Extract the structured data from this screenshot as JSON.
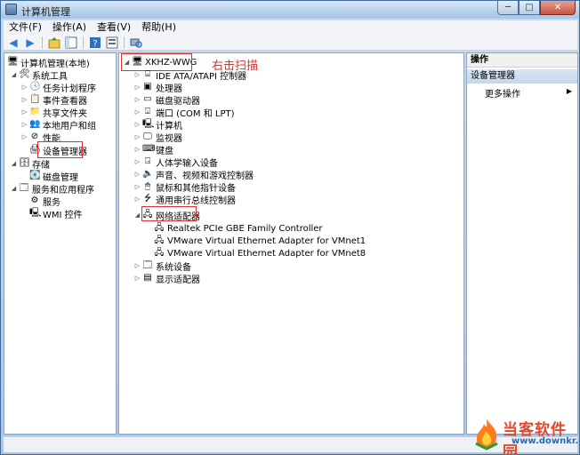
{
  "window": {
    "title": "计算机管理",
    "minimize": "─",
    "maximize": "□",
    "close": "✕"
  },
  "menu": [
    "文件(F)",
    "操作(A)",
    "查看(V)",
    "帮助(H)"
  ],
  "left_tree": {
    "root": "计算机管理(本地)",
    "system_tools": "系统工具",
    "task_scheduler": "任务计划程序",
    "event_viewer": "事件查看器",
    "shared_folders": "共享文件夹",
    "local_users": "本地用户和组",
    "performance": "性能",
    "device_manager": "设备管理器",
    "storage": "存储",
    "disk_management": "磁盘管理",
    "services_apps": "服务和应用程序",
    "services": "服务",
    "wmi": "WMI 控件"
  },
  "device_tree": {
    "computer": "XKHZ-WWG",
    "annotation": "右击扫描",
    "categories": [
      "IDE ATA/ATAPI 控制器",
      "处理器",
      "磁盘驱动器",
      "端口 (COM 和 LPT)",
      "计算机",
      "监视器",
      "键盘",
      "人体学输入设备",
      "声音、视频和游戏控制器",
      "鼠标和其他指针设备",
      "通用串行总线控制器",
      "网络适配器"
    ],
    "network_adapters": [
      "Realtek PCIe GBE Family Controller",
      "VMware Virtual Ethernet Adapter for VMnet1",
      "VMware Virtual Ethernet Adapter for VMnet8"
    ],
    "after": [
      "系统设备",
      "显示适配器"
    ]
  },
  "actions": {
    "header": "操作",
    "section": "设备管理器",
    "more": "更多操作"
  },
  "watermark": {
    "brand": "当客软件园",
    "url": "www.downkr.com"
  }
}
